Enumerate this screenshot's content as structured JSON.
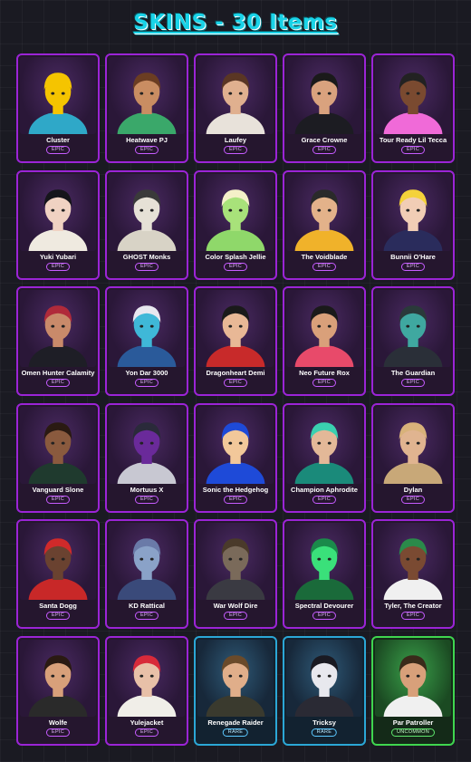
{
  "header": {
    "title": "SKINS - 30 Items"
  },
  "colors": {
    "epic": "#9b24d6",
    "rare": "#2ba7d6",
    "uncommon": "#3fd64f",
    "title": "#19d3e8",
    "background": "#1a1a22"
  },
  "items": [
    {
      "name": "Cluster",
      "rarity": "EPIC",
      "tier": "epic",
      "skin": "#f5c400",
      "hair": "#f5c400",
      "outfit": "#2fa8c8",
      "icon": "yellow-duck-head-with-sunglasses"
    },
    {
      "name": "Heatwave PJ",
      "rarity": "EPIC",
      "tier": "epic",
      "skin": "#c98d62",
      "hair": "#6b3d22",
      "outfit": "#3aa86a",
      "icon": "character-portrait"
    },
    {
      "name": "Laufey",
      "rarity": "EPIC",
      "tier": "epic",
      "skin": "#e0b08f",
      "hair": "#5a3624",
      "outfit": "#e8e2da",
      "icon": "character-portrait"
    },
    {
      "name": "Grace Crowne",
      "rarity": "EPIC",
      "tier": "epic",
      "skin": "#d9a27e",
      "hair": "#1a1a1a",
      "outfit": "#1c1c22",
      "icon": "character-portrait"
    },
    {
      "name": "Tour Ready Lil Tecca",
      "rarity": "EPIC",
      "tier": "epic",
      "skin": "#7a4a30",
      "hair": "#222222",
      "outfit": "#f06ad8",
      "icon": "character-portrait"
    },
    {
      "name": "Yuki Yubari",
      "rarity": "EPIC",
      "tier": "epic",
      "skin": "#f0d2c2",
      "hair": "#15151a",
      "outfit": "#efeae0",
      "icon": "character-portrait"
    },
    {
      "name": "GHOST Monks",
      "rarity": "EPIC",
      "tier": "epic",
      "skin": "#e6e1d6",
      "hair": "#3a3a3a",
      "outfit": "#d8d3c6",
      "icon": "monkey-mask-portrait"
    },
    {
      "name": "Color Splash Jellie",
      "rarity": "EPIC",
      "tier": "epic",
      "skin": "#a8e27a",
      "hair": "#f4f0c8",
      "outfit": "#8fd86a",
      "icon": "character-portrait"
    },
    {
      "name": "The Voidblade",
      "rarity": "EPIC",
      "tier": "epic",
      "skin": "#e3b28a",
      "hair": "#2a2a2a",
      "outfit": "#f0b22a",
      "icon": "character-portrait"
    },
    {
      "name": "Bunnii O'Hare",
      "rarity": "EPIC",
      "tier": "epic",
      "skin": "#f1cdb5",
      "hair": "#f4d23a",
      "outfit": "#2a2c5c",
      "icon": "character-portrait"
    },
    {
      "name": "Omen Hunter Calamity",
      "rarity": "EPIC",
      "tier": "epic",
      "skin": "#c98a6a",
      "hair": "#b02a3a",
      "outfit": "#1e1e26",
      "icon": "character-portrait"
    },
    {
      "name": "Yon Dar 3000",
      "rarity": "EPIC",
      "tier": "epic",
      "skin": "#3fb8d8",
      "hair": "#e8e8f0",
      "outfit": "#2a5a9a",
      "icon": "robot-portrait"
    },
    {
      "name": "Dragonheart Demi",
      "rarity": "EPIC",
      "tier": "epic",
      "skin": "#e8b896",
      "hair": "#1a1a1a",
      "outfit": "#c82a2a",
      "icon": "character-portrait"
    },
    {
      "name": "Neo Future Rox",
      "rarity": "EPIC",
      "tier": "epic",
      "skin": "#d9a07a",
      "hair": "#1a1a1a",
      "outfit": "#e84a6a",
      "icon": "character-portrait"
    },
    {
      "name": "The Guardian",
      "rarity": "EPIC",
      "tier": "epic",
      "skin": "#3fa8a0",
      "hair": "#2a3a3a",
      "outfit": "#2a2f38",
      "icon": "robot-portrait"
    },
    {
      "name": "Vanguard Slone",
      "rarity": "EPIC",
      "tier": "epic",
      "skin": "#8a5a3e",
      "hair": "#2a1a12",
      "outfit": "#1f3a2e",
      "icon": "character-portrait"
    },
    {
      "name": "Mortuus X",
      "rarity": "EPIC",
      "tier": "epic",
      "skin": "#6a2a9a",
      "hair": "#2a2a3a",
      "outfit": "#c8c8d2",
      "icon": "skull-mask-portrait"
    },
    {
      "name": "Sonic the Hedgehog",
      "rarity": "EPIC",
      "tier": "epic",
      "skin": "#f2c89a",
      "hair": "#1e4ad8",
      "outfit": "#1e4ad8",
      "icon": "hedgehog-portrait"
    },
    {
      "name": "Champion Aphrodite",
      "rarity": "EPIC",
      "tier": "epic",
      "skin": "#e3b898",
      "hair": "#3ad0b0",
      "outfit": "#1a8a7a",
      "icon": "character-portrait"
    },
    {
      "name": "Dylan",
      "rarity": "EPIC",
      "tier": "epic",
      "skin": "#e0b490",
      "hair": "#d8b27a",
      "outfit": "#c8a878",
      "icon": "character-portrait"
    },
    {
      "name": "Santa Dogg",
      "rarity": "EPIC",
      "tier": "epic",
      "skin": "#6a4230",
      "hair": "#d02a2a",
      "outfit": "#c82828",
      "icon": "character-portrait"
    },
    {
      "name": "KD Rattical",
      "rarity": "EPIC",
      "tier": "epic",
      "skin": "#8aa2c8",
      "hair": "#6a7aa8",
      "outfit": "#3a4a7a",
      "icon": "rat-portrait"
    },
    {
      "name": "War Wolf Dire",
      "rarity": "EPIC",
      "tier": "epic",
      "skin": "#7a6a5a",
      "hair": "#4a3a2a",
      "outfit": "#3a3a42",
      "icon": "wolf-portrait"
    },
    {
      "name": "Spectral Devourer",
      "rarity": "EPIC",
      "tier": "epic",
      "skin": "#3ae07a",
      "hair": "#1a8a4a",
      "outfit": "#1a6a3a",
      "icon": "ghost-portrait"
    },
    {
      "name": "Tyler, The Creator",
      "rarity": "EPIC",
      "tier": "epic",
      "skin": "#7a4a32",
      "hair": "#2a8a4a",
      "outfit": "#f0f0f0",
      "icon": "character-portrait"
    },
    {
      "name": "Wolfe",
      "rarity": "EPIC",
      "tier": "epic",
      "skin": "#d8a07a",
      "hair": "#2a1a12",
      "outfit": "#2a2a2a",
      "icon": "character-portrait"
    },
    {
      "name": "Yulejacket",
      "rarity": "EPIC",
      "tier": "epic",
      "skin": "#e8c0a8",
      "hair": "#d82a3a",
      "outfit": "#f0eee8",
      "icon": "character-portrait"
    },
    {
      "name": "Renegade Raider",
      "rarity": "RARE",
      "tier": "rare",
      "skin": "#e0ae8a",
      "hair": "#6a4a2a",
      "outfit": "#3a3a2e",
      "icon": "character-portrait"
    },
    {
      "name": "Tricksy",
      "rarity": "RARE",
      "tier": "rare",
      "skin": "#e8e8ee",
      "hair": "#1a1a22",
      "outfit": "#2a2a34",
      "icon": "masked-hood-portrait"
    },
    {
      "name": "Par Patroller",
      "rarity": "UNCOMMON",
      "tier": "uncommon",
      "skin": "#d8a07a",
      "hair": "#3a2a1a",
      "outfit": "#f0f0f0",
      "icon": "character-portrait"
    }
  ]
}
